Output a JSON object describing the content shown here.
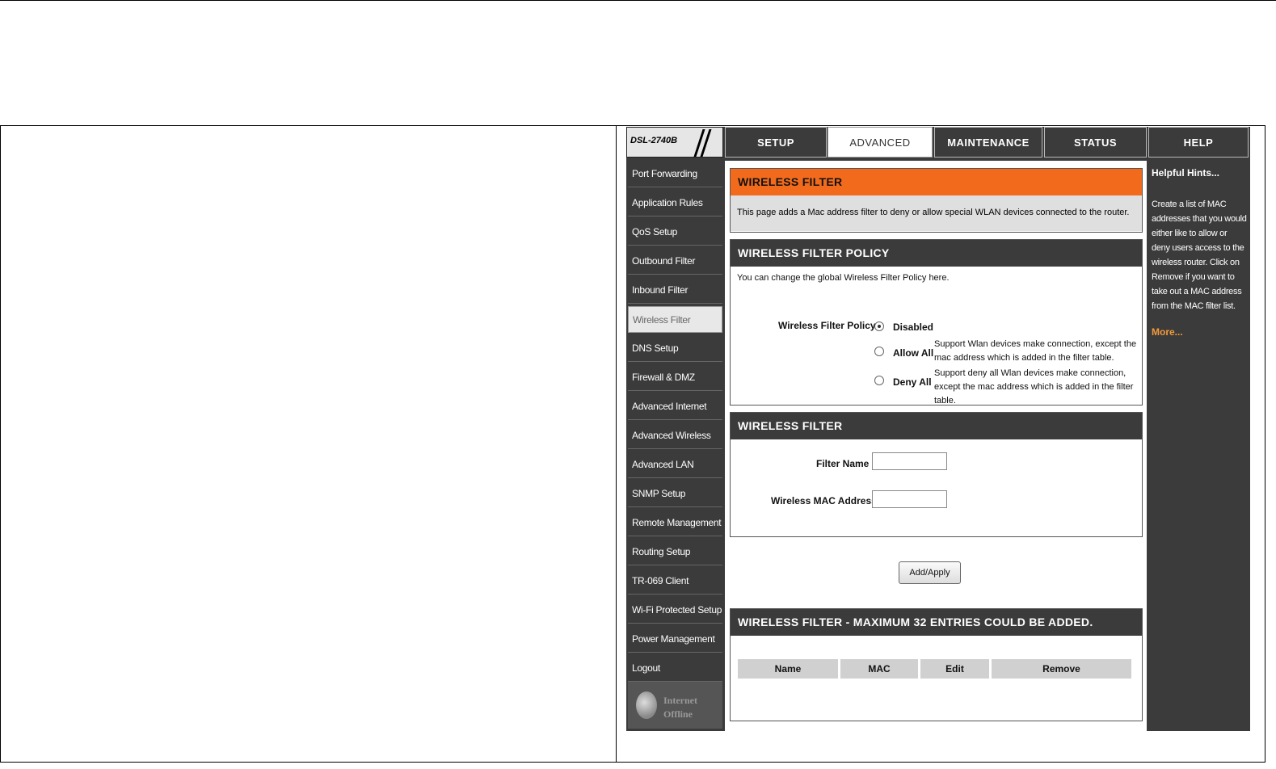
{
  "brand": {
    "model": "DSL-2740B"
  },
  "tabs": [
    {
      "label": "SETUP"
    },
    {
      "label": "ADVANCED"
    },
    {
      "label": "MAINTENANCE"
    },
    {
      "label": "STATUS"
    },
    {
      "label": "HELP"
    }
  ],
  "sidebar": {
    "items": [
      {
        "label": "Port Forwarding"
      },
      {
        "label": "Application Rules"
      },
      {
        "label": "QoS Setup"
      },
      {
        "label": "Outbound Filter"
      },
      {
        "label": "Inbound Filter"
      },
      {
        "label": "Wireless Filter"
      },
      {
        "label": "DNS Setup"
      },
      {
        "label": "Firewall & DMZ"
      },
      {
        "label": "Advanced Internet"
      },
      {
        "label": "Advanced Wireless"
      },
      {
        "label": "Advanced LAN"
      },
      {
        "label": "SNMP Setup"
      },
      {
        "label": "Remote Management"
      },
      {
        "label": "Routing Setup"
      },
      {
        "label": "TR-069 Client"
      },
      {
        "label": "Wi-Fi Protected Setup"
      },
      {
        "label": "Power Management"
      },
      {
        "label": "Logout"
      }
    ],
    "status_line1": "Internet",
    "status_line2": "Offline"
  },
  "intro": {
    "title": "WIRELESS FILTER",
    "text": "This page adds a Mac address filter to deny or allow special WLAN devices connected to the router."
  },
  "policy": {
    "title": "WIRELESS FILTER POLICY",
    "text": "You can change the global Wireless Filter Policy here.",
    "field_label": "Wireless Filter Policy :",
    "options": [
      {
        "label": "Disabled",
        "checked": true,
        "desc": ""
      },
      {
        "label": "Allow All",
        "checked": false,
        "desc": "Support Wlan devices make connection, except the mac address which is added in the filter table."
      },
      {
        "label": "Deny All",
        "checked": false,
        "desc": "Support deny all Wlan devices make connection, except the mac address which is added in the filter table."
      }
    ]
  },
  "filter": {
    "title": "WIRELESS FILTER",
    "name_label": "Filter Name :",
    "name_value": "",
    "mac_label": "Wireless MAC Address :",
    "mac_value": ""
  },
  "add_button": "Add/Apply",
  "table": {
    "title": "WIRELESS FILTER - MAXIMUM 32 ENTRIES COULD BE ADDED.",
    "columns": [
      "Name",
      "MAC",
      "Edit",
      "Remove"
    ]
  },
  "hints": {
    "title": "Helpful Hints...",
    "text": "Create a list of MAC addresses that you would either like to allow or deny users access to the wireless router. Click on Remove if you want to take out a MAC address from the MAC filter list.",
    "more": "More..."
  },
  "colors": {
    "orange": "#f26b1d",
    "dark": "#3b3b3b",
    "more_link": "#f29a3d"
  }
}
